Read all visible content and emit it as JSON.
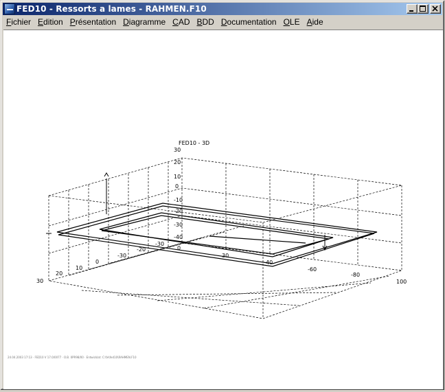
{
  "window": {
    "title": "FED10 - Ressorts a lames  -  RAHMEN.F10"
  },
  "menu": [
    {
      "mnemonic": "F",
      "rest": "ichier"
    },
    {
      "mnemonic": "E",
      "rest": "dition"
    },
    {
      "mnemonic": "P",
      "rest": "résentation"
    },
    {
      "mnemonic": "D",
      "rest": "iagramme"
    },
    {
      "mnemonic": "C",
      "rest": "AD"
    },
    {
      "mnemonic": "B",
      "rest": "DD"
    },
    {
      "mnemonic": "D",
      "rest": "ocumentation"
    },
    {
      "mnemonic": "O",
      "rest": "LE"
    },
    {
      "mnemonic": "A",
      "rest": "ide"
    }
  ],
  "plot": {
    "title": "FED10 - 3D",
    "vertical_axis_ticks": [
      "30",
      "20",
      "10",
      "0",
      "-10",
      "-20",
      "-30",
      "-40",
      "0"
    ],
    "left_depth_ticks": [
      "30",
      "20",
      "10",
      "0"
    ],
    "front_axis_ticks": [
      "-30",
      "-20",
      "-30",
      "30",
      "40"
    ],
    "right_axis_ticks": [
      "-60",
      "-80",
      "100"
    ],
    "footer": "24.04.2003 17:13 · FED10 V 17.0/0077 · O.B. 0PR98/00 · Entwicklat: C:\\fe\\fed10\\RAHMEN.F10"
  },
  "colors": {
    "titlebar_start": "#0a246a",
    "titlebar_end": "#a6caf0",
    "frame": "#d4d0c8",
    "plot_background": "#ffffff"
  }
}
